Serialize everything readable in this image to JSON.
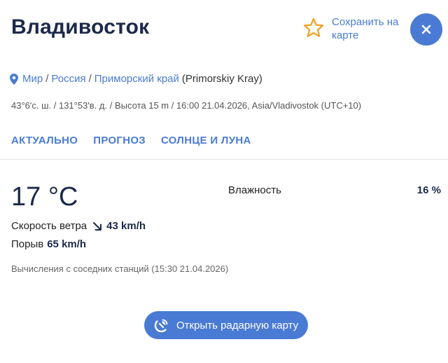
{
  "header": {
    "city": "Владивосток",
    "save_label": "Сохранить на карте",
    "star_icon": "star-outline-icon",
    "close_icon": "close-icon"
  },
  "breadcrumb": {
    "pin_icon": "location-pin-icon",
    "items": [
      "Мир",
      "Россия",
      "Приморский край"
    ],
    "current": "(Primorskiy Kray)"
  },
  "meta": "43°6'с. ш. / 131°53'в. д. / Высота 15 m / 16:00 21.04.2026, Asia/Vladivostok (UTC+10)",
  "tabs": [
    "АКТУАЛЬНО",
    "ПРОГНОЗ",
    "СОЛНЦЕ И ЛУНА"
  ],
  "weather": {
    "temperature": "17 °C",
    "wind_label": "Скорость ветра",
    "wind_value": "43 km/h",
    "wind_icon": "arrow-down-right-icon",
    "gust_label": "Порыв",
    "gust_value": "65 km/h",
    "humidity_label": "Влажность",
    "humidity_value": "16 %",
    "note": "Вычисления с соседних станций (15:30 21.04.2026)"
  },
  "radar": {
    "label": "Открыть радарную карту",
    "icon": "radar-icon"
  },
  "colors": {
    "accent": "#4a7bd4",
    "title": "#1b2a4a",
    "star": "#f0a020"
  }
}
